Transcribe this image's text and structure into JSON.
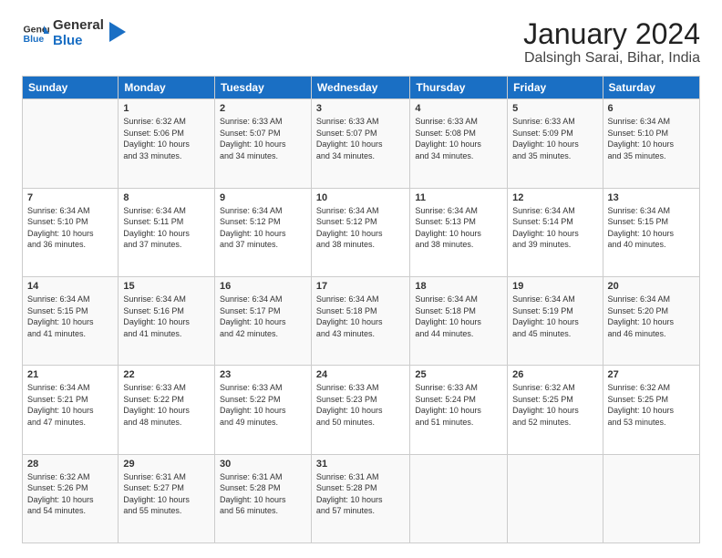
{
  "logo": {
    "line1": "General",
    "line2": "Blue"
  },
  "title": "January 2024",
  "location": "Dalsingh Sarai, Bihar, India",
  "headers": [
    "Sunday",
    "Monday",
    "Tuesday",
    "Wednesday",
    "Thursday",
    "Friday",
    "Saturday"
  ],
  "weeks": [
    [
      {
        "day": "",
        "info": ""
      },
      {
        "day": "1",
        "info": "Sunrise: 6:32 AM\nSunset: 5:06 PM\nDaylight: 10 hours\nand 33 minutes."
      },
      {
        "day": "2",
        "info": "Sunrise: 6:33 AM\nSunset: 5:07 PM\nDaylight: 10 hours\nand 34 minutes."
      },
      {
        "day": "3",
        "info": "Sunrise: 6:33 AM\nSunset: 5:07 PM\nDaylight: 10 hours\nand 34 minutes."
      },
      {
        "day": "4",
        "info": "Sunrise: 6:33 AM\nSunset: 5:08 PM\nDaylight: 10 hours\nand 34 minutes."
      },
      {
        "day": "5",
        "info": "Sunrise: 6:33 AM\nSunset: 5:09 PM\nDaylight: 10 hours\nand 35 minutes."
      },
      {
        "day": "6",
        "info": "Sunrise: 6:34 AM\nSunset: 5:10 PM\nDaylight: 10 hours\nand 35 minutes."
      }
    ],
    [
      {
        "day": "7",
        "info": "Sunrise: 6:34 AM\nSunset: 5:10 PM\nDaylight: 10 hours\nand 36 minutes."
      },
      {
        "day": "8",
        "info": "Sunrise: 6:34 AM\nSunset: 5:11 PM\nDaylight: 10 hours\nand 37 minutes."
      },
      {
        "day": "9",
        "info": "Sunrise: 6:34 AM\nSunset: 5:12 PM\nDaylight: 10 hours\nand 37 minutes."
      },
      {
        "day": "10",
        "info": "Sunrise: 6:34 AM\nSunset: 5:12 PM\nDaylight: 10 hours\nand 38 minutes."
      },
      {
        "day": "11",
        "info": "Sunrise: 6:34 AM\nSunset: 5:13 PM\nDaylight: 10 hours\nand 38 minutes."
      },
      {
        "day": "12",
        "info": "Sunrise: 6:34 AM\nSunset: 5:14 PM\nDaylight: 10 hours\nand 39 minutes."
      },
      {
        "day": "13",
        "info": "Sunrise: 6:34 AM\nSunset: 5:15 PM\nDaylight: 10 hours\nand 40 minutes."
      }
    ],
    [
      {
        "day": "14",
        "info": "Sunrise: 6:34 AM\nSunset: 5:15 PM\nDaylight: 10 hours\nand 41 minutes."
      },
      {
        "day": "15",
        "info": "Sunrise: 6:34 AM\nSunset: 5:16 PM\nDaylight: 10 hours\nand 41 minutes."
      },
      {
        "day": "16",
        "info": "Sunrise: 6:34 AM\nSunset: 5:17 PM\nDaylight: 10 hours\nand 42 minutes."
      },
      {
        "day": "17",
        "info": "Sunrise: 6:34 AM\nSunset: 5:18 PM\nDaylight: 10 hours\nand 43 minutes."
      },
      {
        "day": "18",
        "info": "Sunrise: 6:34 AM\nSunset: 5:18 PM\nDaylight: 10 hours\nand 44 minutes."
      },
      {
        "day": "19",
        "info": "Sunrise: 6:34 AM\nSunset: 5:19 PM\nDaylight: 10 hours\nand 45 minutes."
      },
      {
        "day": "20",
        "info": "Sunrise: 6:34 AM\nSunset: 5:20 PM\nDaylight: 10 hours\nand 46 minutes."
      }
    ],
    [
      {
        "day": "21",
        "info": "Sunrise: 6:34 AM\nSunset: 5:21 PM\nDaylight: 10 hours\nand 47 minutes."
      },
      {
        "day": "22",
        "info": "Sunrise: 6:33 AM\nSunset: 5:22 PM\nDaylight: 10 hours\nand 48 minutes."
      },
      {
        "day": "23",
        "info": "Sunrise: 6:33 AM\nSunset: 5:22 PM\nDaylight: 10 hours\nand 49 minutes."
      },
      {
        "day": "24",
        "info": "Sunrise: 6:33 AM\nSunset: 5:23 PM\nDaylight: 10 hours\nand 50 minutes."
      },
      {
        "day": "25",
        "info": "Sunrise: 6:33 AM\nSunset: 5:24 PM\nDaylight: 10 hours\nand 51 minutes."
      },
      {
        "day": "26",
        "info": "Sunrise: 6:32 AM\nSunset: 5:25 PM\nDaylight: 10 hours\nand 52 minutes."
      },
      {
        "day": "27",
        "info": "Sunrise: 6:32 AM\nSunset: 5:25 PM\nDaylight: 10 hours\nand 53 minutes."
      }
    ],
    [
      {
        "day": "28",
        "info": "Sunrise: 6:32 AM\nSunset: 5:26 PM\nDaylight: 10 hours\nand 54 minutes."
      },
      {
        "day": "29",
        "info": "Sunrise: 6:31 AM\nSunset: 5:27 PM\nDaylight: 10 hours\nand 55 minutes."
      },
      {
        "day": "30",
        "info": "Sunrise: 6:31 AM\nSunset: 5:28 PM\nDaylight: 10 hours\nand 56 minutes."
      },
      {
        "day": "31",
        "info": "Sunrise: 6:31 AM\nSunset: 5:28 PM\nDaylight: 10 hours\nand 57 minutes."
      },
      {
        "day": "",
        "info": ""
      },
      {
        "day": "",
        "info": ""
      },
      {
        "day": "",
        "info": ""
      }
    ]
  ]
}
